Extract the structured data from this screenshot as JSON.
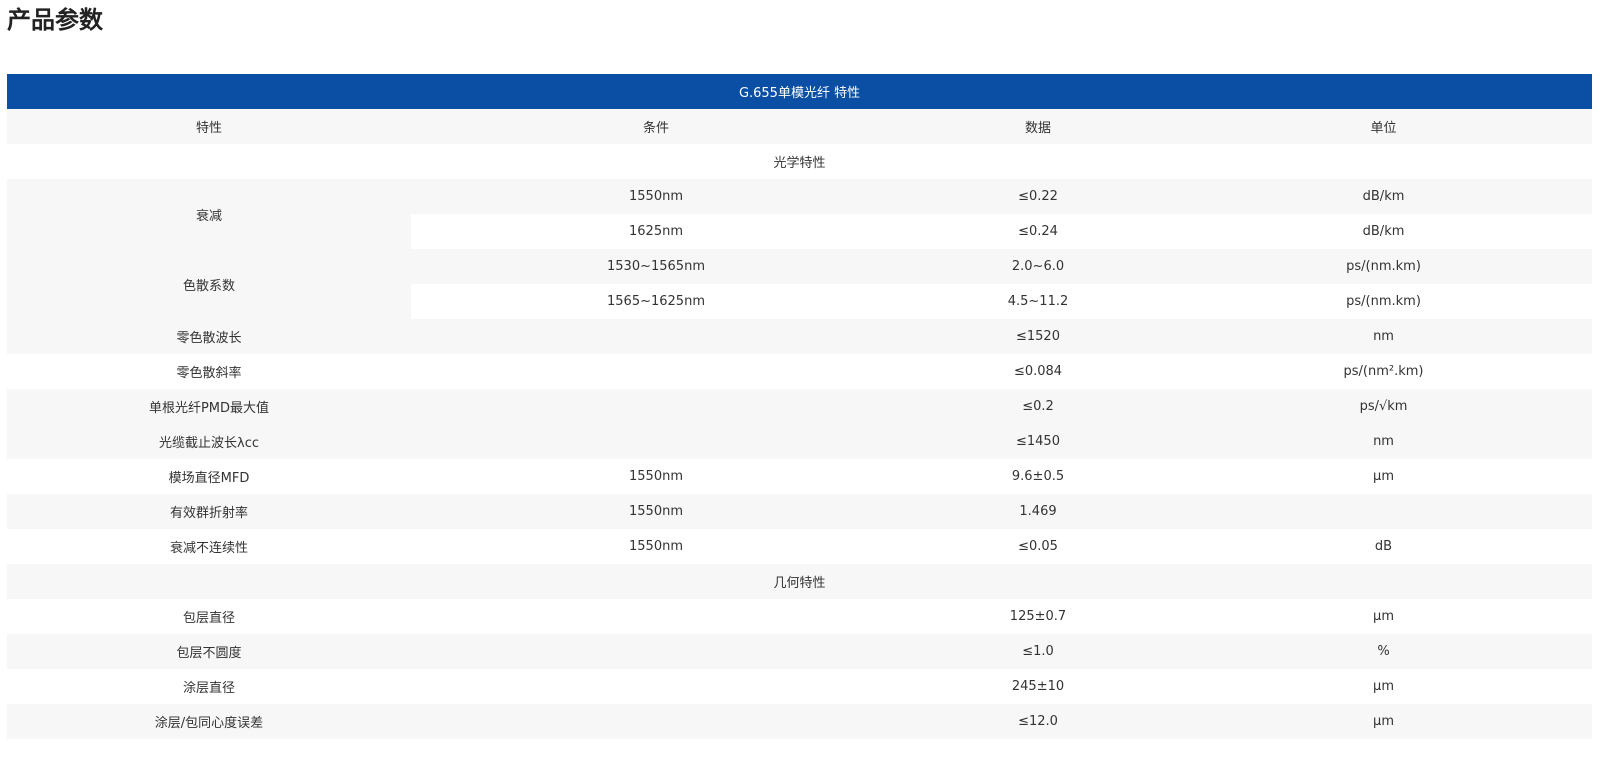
{
  "page_title": "产品参数",
  "table": {
    "title": "G.655单模光纤 特性",
    "headers": [
      "特性",
      "条件",
      "数据",
      "单位"
    ],
    "section_optical": "光学特性",
    "section_geometric": "几何特性",
    "attenuation": {
      "label": "衰减",
      "rows": [
        {
          "condition": "1550nm",
          "value": "≤0.22",
          "unit": "dB/km"
        },
        {
          "condition": "1625nm",
          "value": "≤0.24",
          "unit": "dB/km"
        }
      ]
    },
    "dispersion": {
      "label": "色散系数",
      "rows": [
        {
          "condition": "1530~1565nm",
          "value": "2.0~6.0",
          "unit": "ps/(nm.km)"
        },
        {
          "condition": "1565~1625nm",
          "value": "4.5~11.2",
          "unit": "ps/(nm.km)"
        }
      ]
    },
    "optical_rows": [
      {
        "name": "零色散波长",
        "condition": "",
        "value": "≤1520",
        "unit": "nm"
      },
      {
        "name": "零色散斜率",
        "condition": "",
        "value": "≤0.084",
        "unit": "ps/(nm².km)"
      },
      {
        "name": "单根光纤PMD最大值",
        "condition": "",
        "value": "≤0.2",
        "unit": "ps/√km"
      },
      {
        "name": "光缆截止波长λcc",
        "condition": "",
        "value": "≤1450",
        "unit": "nm"
      },
      {
        "name": "模场直径MFD",
        "condition": "1550nm",
        "value": "9.6±0.5",
        "unit": "μm"
      },
      {
        "name": "有效群折射率",
        "condition": "1550nm",
        "value": "1.469",
        "unit": ""
      },
      {
        "name": "衰减不连续性",
        "condition": "1550nm",
        "value": "≤0.05",
        "unit": "dB"
      }
    ],
    "geometric_rows": [
      {
        "name": "包层直径",
        "condition": "",
        "value": "125±0.7",
        "unit": "μm"
      },
      {
        "name": "包层不圆度",
        "condition": "",
        "value": "≤1.0",
        "unit": "%"
      },
      {
        "name": "涂层直径",
        "condition": "",
        "value": "245±10",
        "unit": "μm"
      },
      {
        "name": "涂层/包同心度误差",
        "condition": "",
        "value": "≤12.0",
        "unit": "μm"
      }
    ]
  }
}
